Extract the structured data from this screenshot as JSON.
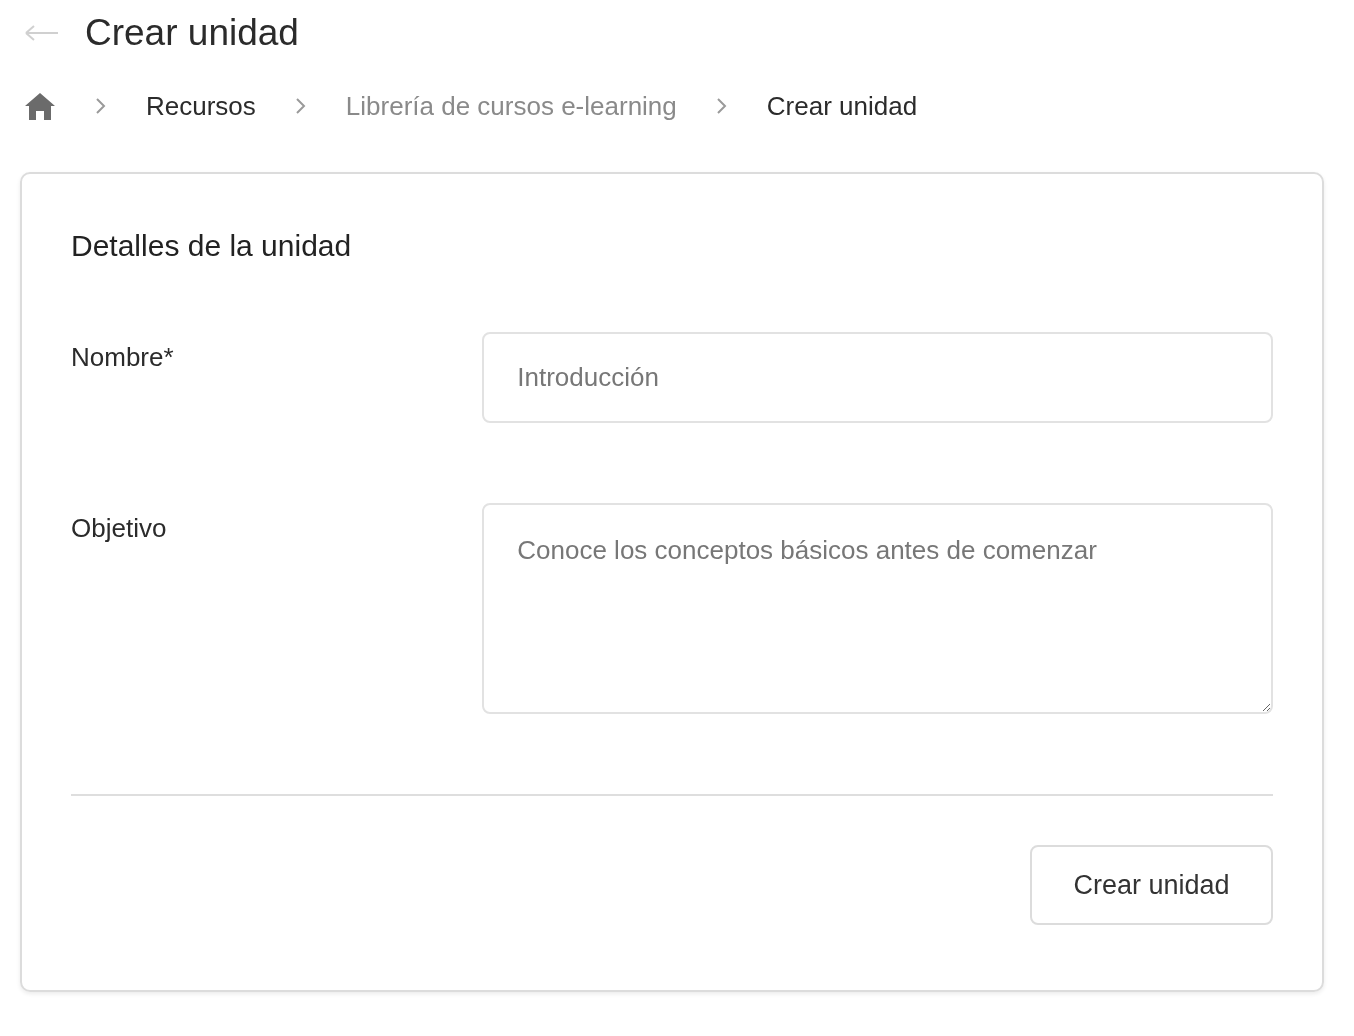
{
  "header": {
    "title": "Crear unidad"
  },
  "breadcrumb": [
    {
      "label": "Recursos",
      "kind": "link"
    },
    {
      "label": "Librería de cursos e-learning",
      "kind": "muted"
    },
    {
      "label": "Crear unidad",
      "kind": "current"
    }
  ],
  "card": {
    "title": "Detalles de la unidad",
    "fields": [
      {
        "label": "Nombre*",
        "kind": "input",
        "placeholder": "Introducción"
      },
      {
        "label": "Objetivo",
        "kind": "textarea",
        "placeholder": "Conoce los conceptos básicos antes de comenzar"
      }
    ],
    "submit": "Crear unidad"
  }
}
